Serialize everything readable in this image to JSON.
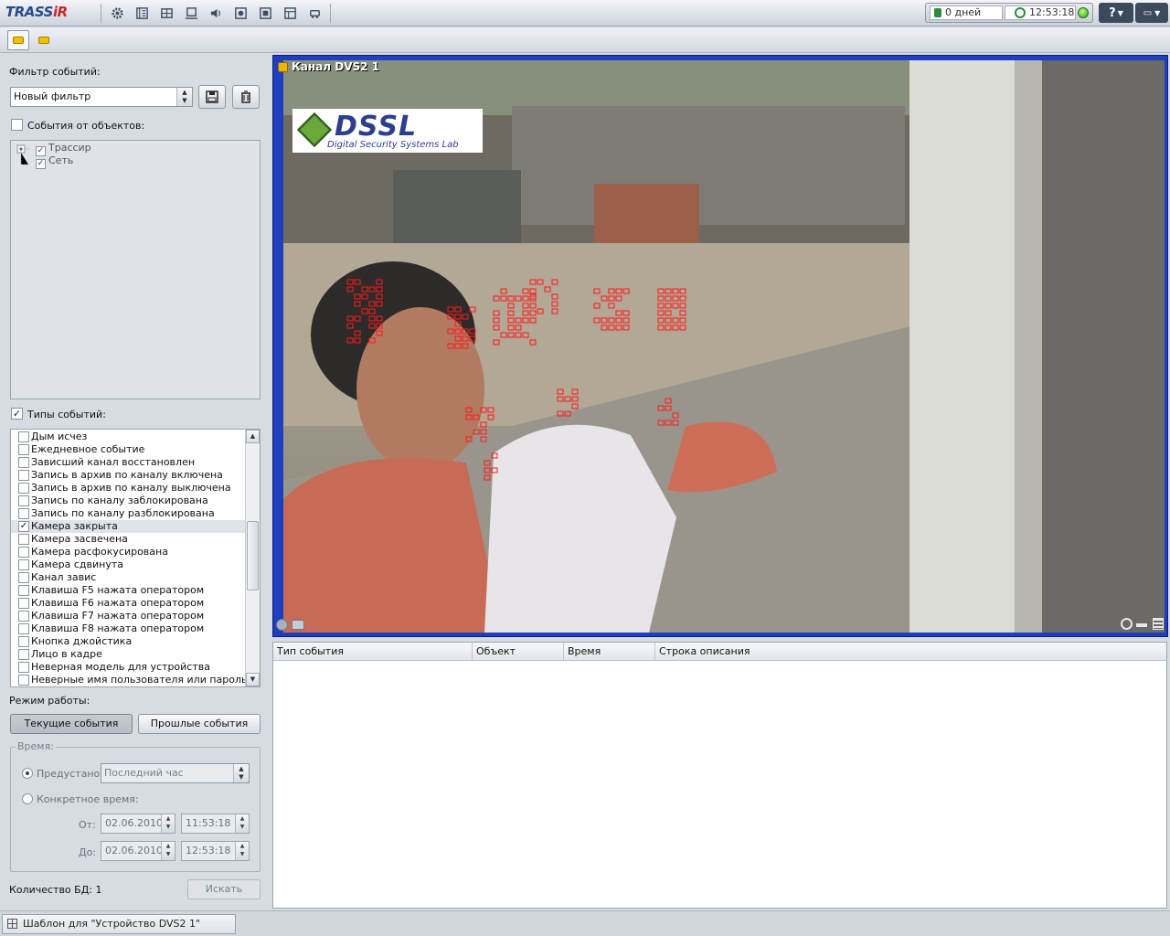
{
  "app": {
    "logo_main": "TRASS",
    "logo_accent": "iR"
  },
  "toolbar": {
    "icons": [
      "settings-icon",
      "archive-icon",
      "layout-icon",
      "monitor-icon",
      "sound-icon",
      "record-icon",
      "stop-icon",
      "templates-icon",
      "vehicle-icon"
    ],
    "days": "0 дней",
    "clock": "12:53:18",
    "help_label": "?",
    "status_color": "#2fa31e"
  },
  "left": {
    "filter_label": "Фильтр событий:",
    "filter_value": "Новый фильтр",
    "objects_label": "События от объектов:",
    "tree": [
      {
        "label": "Трассир",
        "checked": true
      },
      {
        "label": "Сеть",
        "checked": true
      }
    ],
    "types_label": "Типы событий:",
    "types_checked": true,
    "event_types": [
      {
        "label": "Дым исчез",
        "checked": false
      },
      {
        "label": "Ежедневное событие",
        "checked": false
      },
      {
        "label": "Зависший канал восстановлен",
        "checked": false
      },
      {
        "label": "Запись в архив по каналу включена",
        "checked": false
      },
      {
        "label": "Запись в архив по каналу выключена",
        "checked": false
      },
      {
        "label": "Запись по каналу заблокирована",
        "checked": false
      },
      {
        "label": "Запись по каналу разблокирована",
        "checked": false
      },
      {
        "label": "Камера закрыта",
        "checked": true
      },
      {
        "label": "Камера засвечена",
        "checked": false
      },
      {
        "label": "Камера расфокусирована",
        "checked": false
      },
      {
        "label": "Камера сдвинута",
        "checked": false
      },
      {
        "label": "Канал завис",
        "checked": false
      },
      {
        "label": "Клавиша F5 нажата оператором",
        "checked": false
      },
      {
        "label": "Клавиша F6 нажата оператором",
        "checked": false
      },
      {
        "label": "Клавиша F7 нажата оператором",
        "checked": false
      },
      {
        "label": "Клавиша F8 нажата оператором",
        "checked": false
      },
      {
        "label": "Кнопка джойстика",
        "checked": false
      },
      {
        "label": "Лицо в кадре",
        "checked": false
      },
      {
        "label": "Неверная модель для устройства",
        "checked": false
      },
      {
        "label": "Неверные имя пользователя или пароль",
        "checked": false
      }
    ],
    "mode_label": "Режим работы:",
    "current_events": "Текущие события",
    "past_events": "Прошлые события",
    "time_group": "Время:",
    "preset_label": "Предустано",
    "preset_value": "Последний час",
    "specific_label": "Конкретное время:",
    "from_label": "От:",
    "to_label": "До:",
    "from_date": "02.06.2010",
    "from_time": "11:53:18",
    "to_date": "02.06.2010",
    "to_time": "12:53:18",
    "db_count": "Количество БД: 1",
    "search_label": "Искать"
  },
  "video": {
    "title": "Канал DVS2 1",
    "logo_text": "DSSL",
    "logo_sub": "Digital Security Systems Lab"
  },
  "events_table": {
    "columns": [
      "Тип события",
      "Объект",
      "Время",
      "Строка описания"
    ],
    "rows": []
  },
  "bottom": {
    "task": "Шаблон для \"Устройство DVS2 1\""
  }
}
